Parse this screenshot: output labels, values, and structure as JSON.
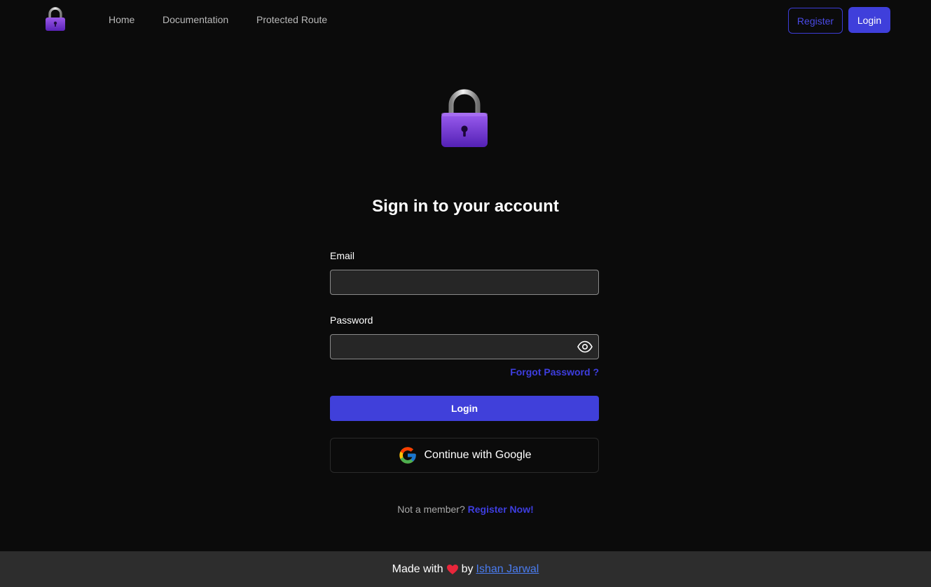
{
  "nav": {
    "logo_icon": "lock-icon",
    "links": [
      "Home",
      "Documentation",
      "Protected Route"
    ],
    "register_label": "Register",
    "login_label": "Login"
  },
  "main": {
    "hero_icon": "lock-icon",
    "title": "Sign in to your account",
    "email_label": "Email",
    "email_value": "",
    "password_label": "Password",
    "password_value": "",
    "password_toggle_icon": "eye-icon",
    "forgot_label": "Forgot Password ?",
    "login_button": "Login",
    "google_icon": "google-icon",
    "google_button": "Continue with Google",
    "member_text": "Not a member?",
    "register_link": "Register Now!"
  },
  "footer": {
    "made_with": "Made with",
    "heart_icon": "heart-icon",
    "by": "by",
    "author": "Ishan Jarwal"
  },
  "colors": {
    "background": "#0b0b0b",
    "accent": "#4040da",
    "input_background": "#262626",
    "footer_background": "#2d2d2d",
    "link": "#4a7cf0"
  }
}
